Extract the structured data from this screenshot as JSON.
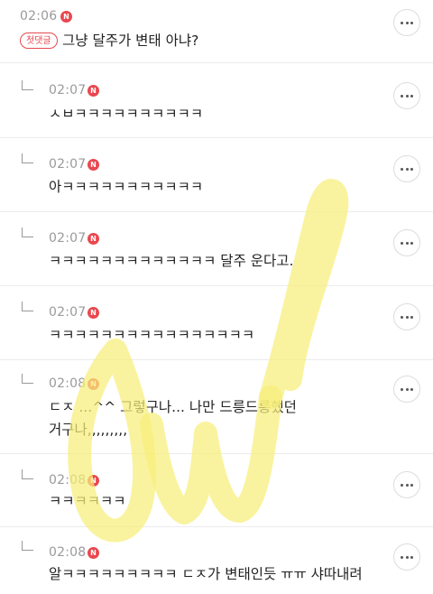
{
  "comments": [
    {
      "time": "02:06",
      "badge": "N",
      "tag": "첫댓글",
      "text": "그냥 달주가 변태 아냐?"
    },
    {
      "time": "02:07",
      "badge": "N",
      "text": "ㅅㅂㅋㅋㅋㅋㅋㅋㅋㅋㅋㅋ"
    },
    {
      "time": "02:07",
      "badge": "N",
      "text": "아ㅋㅋㅋㅋㅋㅋㅋㅋㅋㅋㅋ"
    },
    {
      "time": "02:07",
      "badge": "N",
      "text": "ㅋㅋㅋㅋㅋㅋㅋㅋㅋㅋㅋㅋㅋ 달주 운다고."
    },
    {
      "time": "02:07",
      "badge": "N",
      "text": "ㅋㅋㅋㅋㅋㅋㅋㅋㅋㅋㅋㅋㅋㅋㅋㅋ"
    },
    {
      "time": "02:08",
      "badge": "N",
      "text": "ㄷㅈ ...^^ 그렇구나... 나만 드릉드릉했던",
      "text2": "거구나,,,,,,,,,"
    },
    {
      "time": "02:08",
      "badge": "N",
      "text": "ㅋㅋㅋㅋㅋㅋ"
    },
    {
      "time": "02:08",
      "badge": "N",
      "text": "알ㅋㅋㅋㅋㅋㅋㅋㅋㅋ ㄷㅈ가 변태인듯 ㅠㅠ 샤따내려"
    }
  ],
  "colors": {
    "badge": "#e8484f",
    "watermark": "#f6ee7a"
  },
  "icons": {
    "more": "more-horizontal-icon",
    "reply": "reply-arrow-icon"
  }
}
